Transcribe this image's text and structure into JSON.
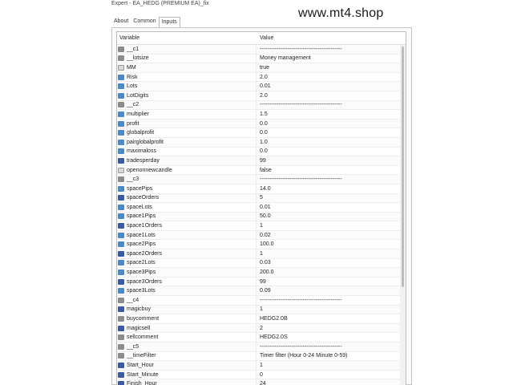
{
  "window": {
    "title": "Expert - EA_HEDG (PREMIUM EA)_fix"
  },
  "watermark": "www.mt4.shop",
  "tabs": [
    {
      "label": "About"
    },
    {
      "label": "Common"
    },
    {
      "label": "Inputs"
    }
  ],
  "grid": {
    "headers": {
      "variable": "Variable",
      "value": "Value"
    },
    "rows": [
      {
        "variable": "__c1",
        "value": "--------------------------------------------",
        "icon": "str"
      },
      {
        "variable": "__lotsize",
        "value": "Money management",
        "icon": "str"
      },
      {
        "variable": "MM",
        "value": "true",
        "icon": "bool"
      },
      {
        "variable": "Risk",
        "value": "2.0",
        "icon": "dbl"
      },
      {
        "variable": "Lots",
        "value": "0.01",
        "icon": "dbl"
      },
      {
        "variable": "LotDigits",
        "value": "2.0",
        "icon": "dbl"
      },
      {
        "variable": "__c2",
        "value": "--------------------------------------------",
        "icon": "str"
      },
      {
        "variable": "multiplier",
        "value": "1.5",
        "icon": "dbl"
      },
      {
        "variable": "profit",
        "value": "0.0",
        "icon": "dbl"
      },
      {
        "variable": "globalprofit",
        "value": "0.0",
        "icon": "dbl"
      },
      {
        "variable": "pairglobalprofit",
        "value": "1.0",
        "icon": "dbl"
      },
      {
        "variable": "maximaloss",
        "value": "0.0",
        "icon": "dbl"
      },
      {
        "variable": "tradesperday",
        "value": "99",
        "icon": "int"
      },
      {
        "variable": "openonnewcandle",
        "value": "false",
        "icon": "bool"
      },
      {
        "variable": "__c3",
        "value": "--------------------------------------------",
        "icon": "str"
      },
      {
        "variable": "spacePips",
        "value": "14.0",
        "icon": "dbl"
      },
      {
        "variable": "spaceOrders",
        "value": "5",
        "icon": "int"
      },
      {
        "variable": "spaceLots",
        "value": "0.01",
        "icon": "dbl"
      },
      {
        "variable": "space1Pips",
        "value": "50.0",
        "icon": "dbl"
      },
      {
        "variable": "space1Orders",
        "value": "1",
        "icon": "int"
      },
      {
        "variable": "space1Lots",
        "value": "0.02",
        "icon": "dbl"
      },
      {
        "variable": "space2Pips",
        "value": "100.0",
        "icon": "dbl"
      },
      {
        "variable": "space2Orders",
        "value": "1",
        "icon": "int"
      },
      {
        "variable": "space2Lots",
        "value": "0.03",
        "icon": "dbl"
      },
      {
        "variable": "space3Pips",
        "value": "200.0",
        "icon": "dbl"
      },
      {
        "variable": "space3Orders",
        "value": "99",
        "icon": "int"
      },
      {
        "variable": "space3Lots",
        "value": "0.09",
        "icon": "dbl"
      },
      {
        "variable": "__c4",
        "value": "--------------------------------------------",
        "icon": "str"
      },
      {
        "variable": "magicbuy",
        "value": "1",
        "icon": "int"
      },
      {
        "variable": "buycomment",
        "value": "HEDG2.0B",
        "icon": "str"
      },
      {
        "variable": "magicsell",
        "value": "2",
        "icon": "int"
      },
      {
        "variable": "sellcomment",
        "value": "HEDG2.0S",
        "icon": "str"
      },
      {
        "variable": "__c5",
        "value": "--------------------------------------------",
        "icon": "str"
      },
      {
        "variable": "__timeFilter",
        "value": "Timer filter (Hour 0-24 Minute 0-59)",
        "icon": "str"
      },
      {
        "variable": "Start_Hour",
        "value": "1",
        "icon": "int"
      },
      {
        "variable": "Start_Minute",
        "value": "0",
        "icon": "int"
      },
      {
        "variable": "Finish_Hour",
        "value": "24",
        "icon": "int"
      }
    ]
  }
}
